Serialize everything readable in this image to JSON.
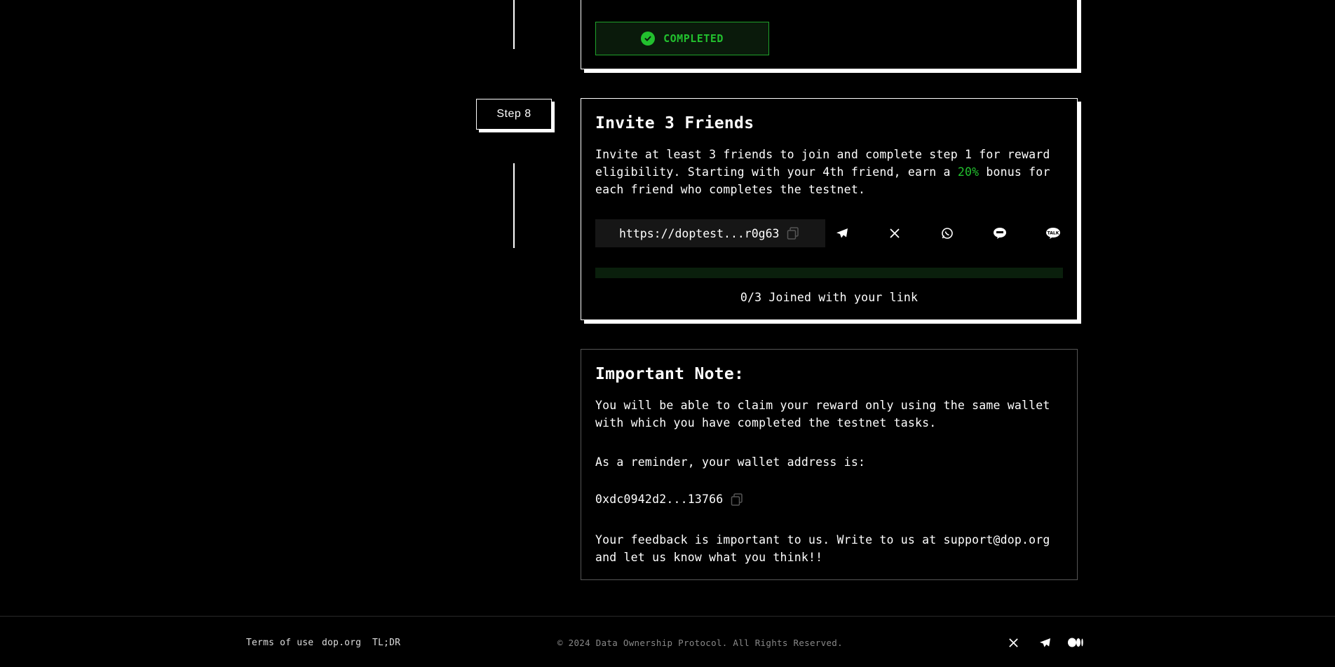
{
  "step7": {
    "status_label": "COMPLETED"
  },
  "step8": {
    "badge_label": "Step 8",
    "title": "Invite 3 Friends",
    "desc_part1": "Invite at least 3 friends to join and complete step 1 for reward eligibility. Starting with your 4th friend, earn a ",
    "desc_highlight": "20%",
    "desc_part2": " bonus for each friend who completes the testnet.",
    "invite_link": "https://doptest...r0g63",
    "share_targets": [
      "telegram-icon",
      "x-icon",
      "whatsapp-icon",
      "line-icon",
      "kakaotalk-icon"
    ],
    "progress_fraction": 0.0,
    "joined_text": "0/3 Joined with your link"
  },
  "note": {
    "title": "Important Note:",
    "text1": "You will be able to claim your reward only using the same wallet with which you have completed the testnet tasks.",
    "text2": "As a reminder, your wallet address is:",
    "wallet_address": "0xdc0942d2...13766",
    "text3": "Your feedback is important to us. Write to us at support@dop.org and let us know what you think!!"
  },
  "footer": {
    "links": [
      "Terms of use",
      "dop.org",
      "TL;DR"
    ],
    "copyright": "© 2024 Data Ownership Protocol. All Rights Reserved.",
    "social": [
      "x-icon",
      "telegram-icon",
      "medium-icon"
    ]
  },
  "colors": {
    "accent": "#22c02e",
    "background": "#000000",
    "text": "#ffffff"
  }
}
